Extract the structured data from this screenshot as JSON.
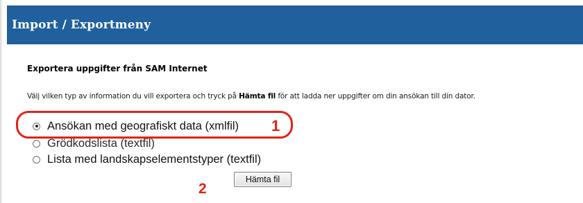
{
  "header": {
    "title": "Import / Exportmeny"
  },
  "export": {
    "section_title": "Exportera uppgifter från SAM Internet",
    "instructions": {
      "before": "Välj vilken typ av information du vill exportera och tryck på ",
      "bold": "Hämta fil",
      "after": " för att ladda ner uppgifter om din ansökan till din dator."
    },
    "options": [
      {
        "label": "Ansökan med geografiskt data (xmlfil)",
        "selected": true
      },
      {
        "label": "Grödkodslista (textfil)",
        "selected": false
      },
      {
        "label": "Lista med landskapselementstyper (textfil)",
        "selected": false
      }
    ],
    "fetch_button": "Hämta fil"
  },
  "annotations": {
    "marker1": "1",
    "marker2": "2",
    "highlight_color": "#e32117"
  },
  "colors": {
    "header_bg": "#20609c",
    "header_text": "#ffffff"
  }
}
